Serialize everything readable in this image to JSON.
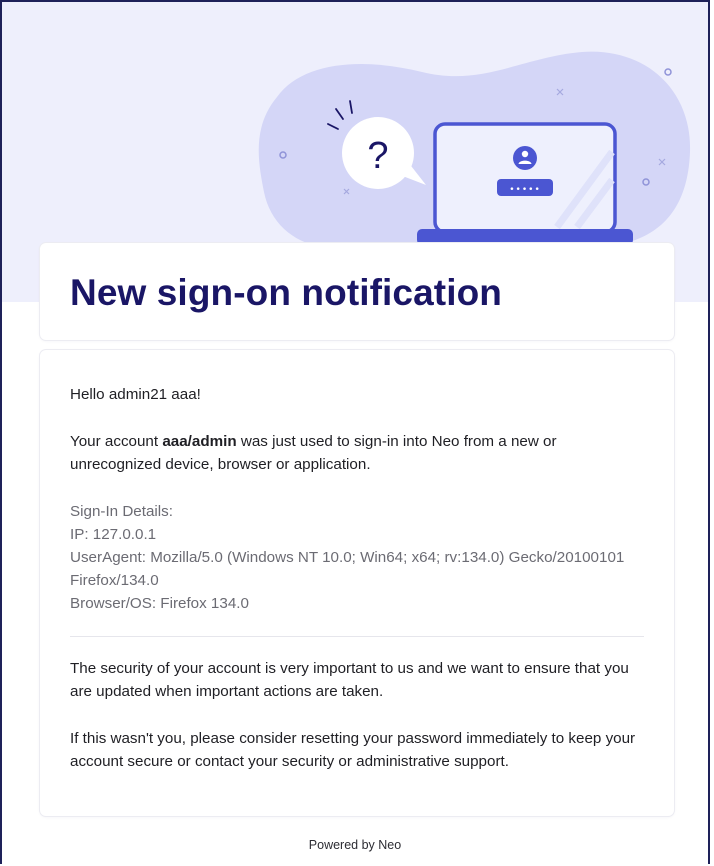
{
  "email": {
    "title": "New sign-on notification",
    "greeting": "Hello admin21 aaa!",
    "intro": {
      "prefix": "Your account ",
      "account": "aaa/admin",
      "suffix": " was just used to sign-in into Neo from a new or unrecognized device, browser or application."
    },
    "details": {
      "heading": "Sign-In Details:",
      "ip": "IP: 127.0.0.1",
      "user_agent": "UserAgent: Mozilla/5.0 (Windows NT 10.0; Win64; x64; rv:134.0) Gecko/20100101 Firefox/134.0",
      "browser_os": "Browser/OS: Firefox 134.0"
    },
    "security_note": "The security of your account is very important to us and we want to ensure that you are updated when important actions are taken.",
    "reset_note": "If this wasn't you, please consider resetting your password immediately to keep your account secure or contact your security or administrative support.",
    "footer": "Powered by Neo"
  },
  "illustration": {
    "question_mark": "?",
    "password_dots": "•••••"
  },
  "colors": {
    "brand_dark": "#1a1666",
    "illustration_primary": "#4b56d2",
    "hero_background": "#eeeffc",
    "blob": "#d4d6f7"
  }
}
